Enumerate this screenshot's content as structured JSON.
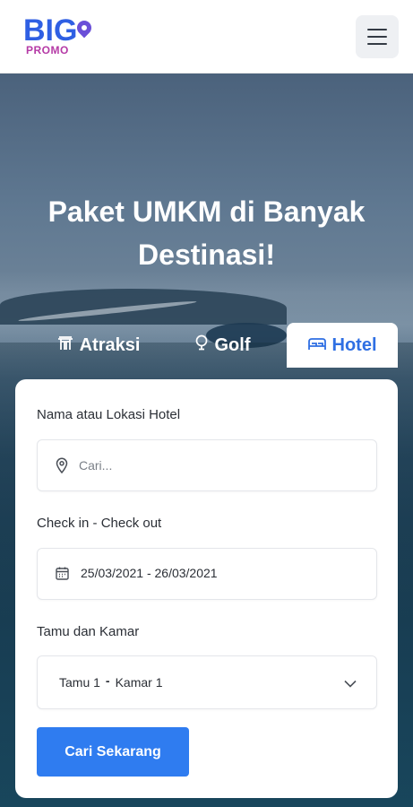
{
  "header": {
    "logo": {
      "big": "BIG",
      "promo": "PROMO"
    },
    "menu_icon": "hamburger-menu-icon"
  },
  "hero": {
    "title_line1": "Paket UMKM di Banyak",
    "title_line2": "Destinasi!"
  },
  "tabs": [
    {
      "label": "Atraksi",
      "icon": "gate-icon",
      "active": false
    },
    {
      "label": "Golf",
      "icon": "golf-icon",
      "active": false
    },
    {
      "label": "Hotel",
      "icon": "bed-icon",
      "active": true
    }
  ],
  "form": {
    "location": {
      "label": "Nama atau Lokasi Hotel",
      "placeholder": "Cari...",
      "icon": "location-pin-icon"
    },
    "dates": {
      "label": "Check in - Check out",
      "value": "25/03/2021 - 26/03/2021",
      "icon": "calendar-icon"
    },
    "guests": {
      "label": "Tamu dan Kamar",
      "guests_text": "Tamu 1",
      "separator": "-",
      "rooms_text": "Kamar 1",
      "icon": "chevron-down-icon"
    },
    "submit_label": "Cari Sekarang"
  },
  "colors": {
    "accent": "#2f7cf0",
    "tab_active_text": "#2f6fe3",
    "logo_blue": "#2f5fe3",
    "logo_purple": "#b53aa6"
  }
}
